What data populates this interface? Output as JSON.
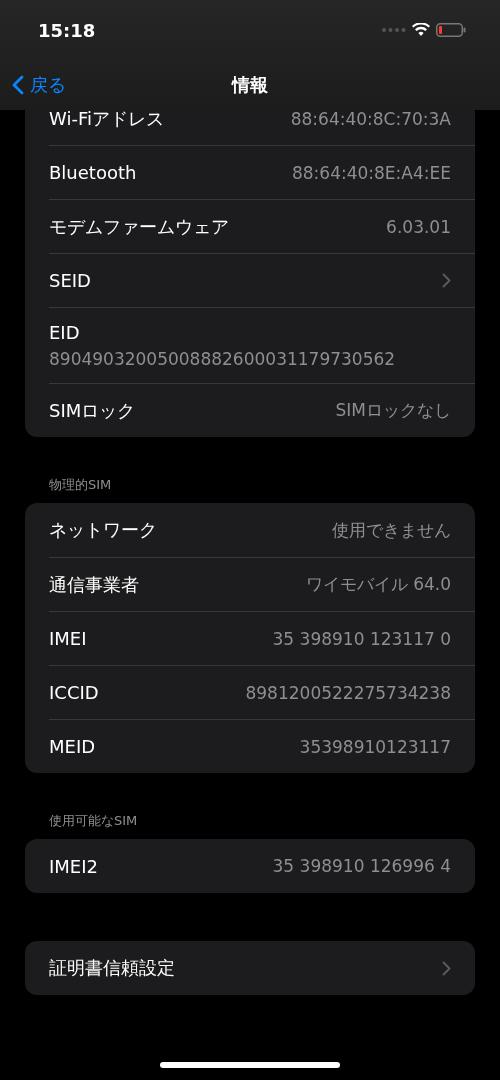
{
  "status_bar": {
    "time": "15:18"
  },
  "nav": {
    "back": "戻る",
    "title": "情報"
  },
  "sections": [
    {
      "clipped_top": true,
      "rows": [
        {
          "kind": "value",
          "label": "Wi-Fiアドレス",
          "value": "88:64:40:8C:70:3A"
        },
        {
          "kind": "value",
          "label": "Bluetooth",
          "value": "88:64:40:8E:A4:EE"
        },
        {
          "kind": "value",
          "label": "モデムファームウェア",
          "value": "6.03.01"
        },
        {
          "kind": "link",
          "label": "SEID"
        },
        {
          "kind": "stacked",
          "label": "EID",
          "value": "89049032005008882600031179730562"
        },
        {
          "kind": "value",
          "label": "SIMロック",
          "value": "SIMロックなし"
        }
      ]
    },
    {
      "header": "物理的SIM",
      "rows": [
        {
          "kind": "value",
          "label": "ネットワーク",
          "value": "使用できません"
        },
        {
          "kind": "value",
          "label": "通信事業者",
          "value": "ワイモバイル 64.0"
        },
        {
          "kind": "value",
          "label": "IMEI",
          "value": "35 398910 123117 0"
        },
        {
          "kind": "value",
          "label": "ICCID",
          "value": "8981200522275734238"
        },
        {
          "kind": "value",
          "label": "MEID",
          "value": "35398910123117"
        }
      ]
    },
    {
      "header": "使用可能なSIM",
      "rows": [
        {
          "kind": "value",
          "label": "IMEI2",
          "value": "35 398910 126996 4"
        }
      ]
    },
    {
      "rows": [
        {
          "kind": "link",
          "label": "証明書信頼設定"
        }
      ]
    }
  ]
}
